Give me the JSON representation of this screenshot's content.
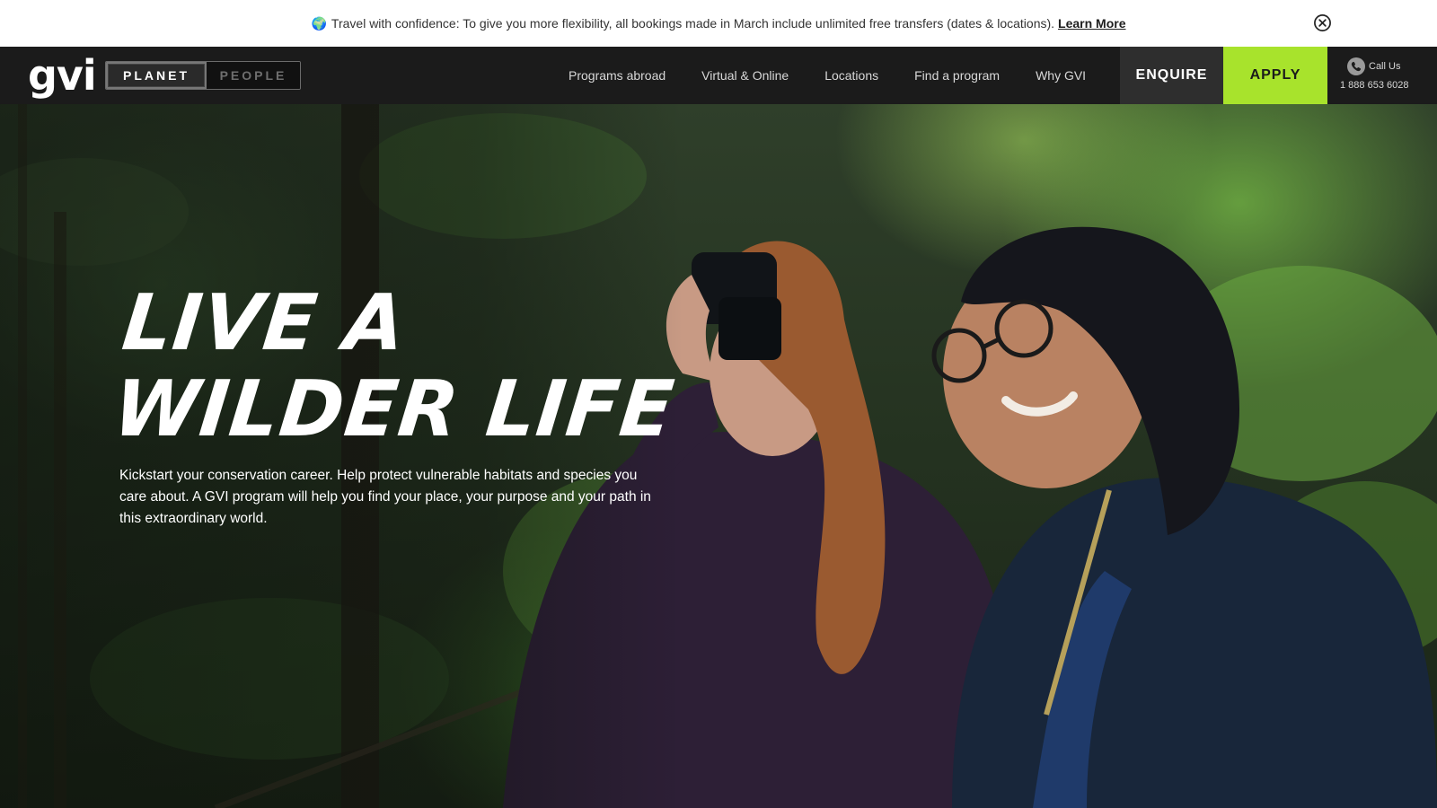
{
  "announcement": {
    "globe": "🌍",
    "message": "Travel with confidence: To give you more flexibility, all bookings made in March include unlimited free transfers (dates & locations).",
    "link_label": "Learn More",
    "close_icon": "close-circle-icon"
  },
  "header": {
    "logo": "gvi",
    "toggle": {
      "active": "PLANET",
      "inactive": "PEOPLE"
    },
    "nav": [
      "Programs abroad",
      "Virtual & Online",
      "Locations",
      "Find a program",
      "Why GVI"
    ],
    "enquire_label": "ENQUIRE",
    "apply_label": "APPLY",
    "call": {
      "label": "Call Us",
      "number": "1 888 653 6028",
      "icon": "phone-icon"
    }
  },
  "hero": {
    "headline_line1": "LIVE A",
    "headline_line2": "WILDER LIFE",
    "subtext": "Kickstart your conservation career. Help protect vulnerable habitats and species you care about. A GVI program will help you find your place, your purpose and your path in this extraordinary world."
  },
  "colors": {
    "accent": "#a8e32c",
    "header_bg": "#1b1b1b",
    "enquire_bg": "#2e2e2e"
  }
}
